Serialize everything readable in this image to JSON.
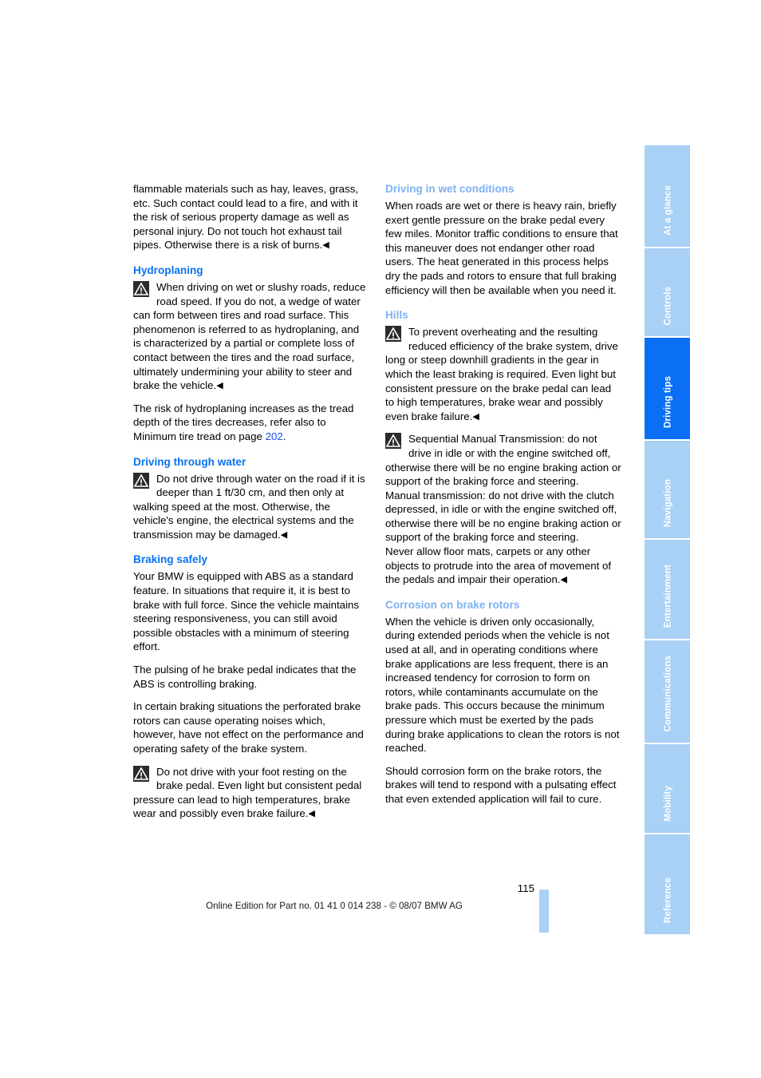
{
  "document": {
    "page_number": "115",
    "footer_note": "Online Edition for Part no. 01 41 0 014 238 - © 08/07 BMW AG",
    "colors": {
      "heading_strong_blue": "#0a72f0",
      "heading_light_blue": "#7eb1f2",
      "tab_inactive": "#a9d0f5",
      "tab_active": "#0b6ff5",
      "link_blue": "#1a50e8",
      "warning_icon_bg": "#2b2b2b"
    }
  },
  "left_column": {
    "continued_paragraph": "flammable materials such as hay, leaves, grass, etc. Such contact could lead to a fire, and with it the risk of serious property damage as well as personal injury. Do not touch hot exhaust tail pipes. Otherwise there is a risk of burns.",
    "hydroplaning": {
      "heading": "Hydroplaning",
      "warning": "When driving on wet or slushy roads, reduce road speed. If you do not, a wedge of water can form between tires and road surface. This phenomenon is referred to as hydroplaning, and is characterized by a partial or complete loss of contact between the tires and the road surface, ultimately undermining your ability to steer and brake the vehicle.",
      "para_prefix": "The risk of hydroplaning increases as the tread depth of the tires decreases, refer also to Minimum tire tread on page ",
      "page_ref": "202",
      "para_suffix": "."
    },
    "driving_through_water": {
      "heading": "Driving through water",
      "warning": "Do not drive through water on the road if it is deeper than 1 ft/30 cm, and then only at walking speed at the most. Otherwise, the vehicle's engine, the electrical systems and the transmission may be damaged."
    },
    "braking_safely": {
      "heading": "Braking safely",
      "para1": "Your BMW is equipped with ABS as a standard feature. In situations that require it, it is best to brake with full force. Since the vehicle maintains steering responsiveness, you can still avoid possible obstacles with a minimum of steering effort.",
      "para2": "The pulsing of he brake pedal indicates that the ABS is controlling braking.",
      "para3": "In certain braking situations the perforated brake rotors can cause operating noises which, however, have not effect on the performance and operating safety of the brake system.",
      "warning": "Do not drive with your foot resting on the brake pedal. Even light but consistent pedal pressure can lead to high temperatures, brake wear and possibly even brake failure."
    }
  },
  "right_column": {
    "driving_in_wet_conditions": {
      "heading": "Driving in wet conditions",
      "para1": "When roads are wet or there is heavy rain, briefly exert gentle pressure on the brake pedal every few miles. Monitor traffic conditions to ensure that this maneuver does not endanger other road users. The heat generated in this process helps dry the pads and rotors to ensure that full braking efficiency will then be available when you need it."
    },
    "hills": {
      "heading": "Hills",
      "warning1": "To prevent overheating and the resulting reduced efficiency of the brake system, drive long or steep downhill gradients in the gear in which the least braking is required. Even light but consistent pressure on the brake pedal can lead to high temperatures, brake wear and possibly even brake failure.",
      "warning2_line1": "Sequential Manual Transmission: do not drive in idle or with the engine switched off, otherwise there will be no engine braking action or support of the braking force and steering.",
      "warning2_line2": "Manual transmission: do not drive with the clutch depressed, in idle or with the engine switched off, otherwise there will be no engine braking action or support of the braking force and steering.",
      "warning2_line3": "Never allow floor mats, carpets or any other objects to protrude into the area of movement of the pedals and impair their operation."
    },
    "corrosion_on_brake_rotors": {
      "heading": "Corrosion on brake rotors",
      "para1": "When the vehicle is driven only occasionally, during extended periods when the vehicle is not used at all, and in operating conditions where brake applications are less frequent, there is an increased tendency for corrosion to form on rotors, while contaminants accumulate on the brake pads. This occurs because the minimum pressure which must be exerted by the pads during brake applications to clean the rotors is not reached.",
      "para2": "Should corrosion form on the brake rotors, the brakes will tend to respond with a pulsating effect that even extended application will fail to cure."
    }
  },
  "tab_strip": {
    "tabs": [
      {
        "label": "At a glance",
        "active": false
      },
      {
        "label": "Controls",
        "active": false
      },
      {
        "label": "Driving tips",
        "active": true
      },
      {
        "label": "Navigation",
        "active": false
      },
      {
        "label": "Entertainment",
        "active": false
      },
      {
        "label": "Communications",
        "active": false
      },
      {
        "label": "Mobility",
        "active": false
      },
      {
        "label": "Reference",
        "active": false
      }
    ]
  }
}
